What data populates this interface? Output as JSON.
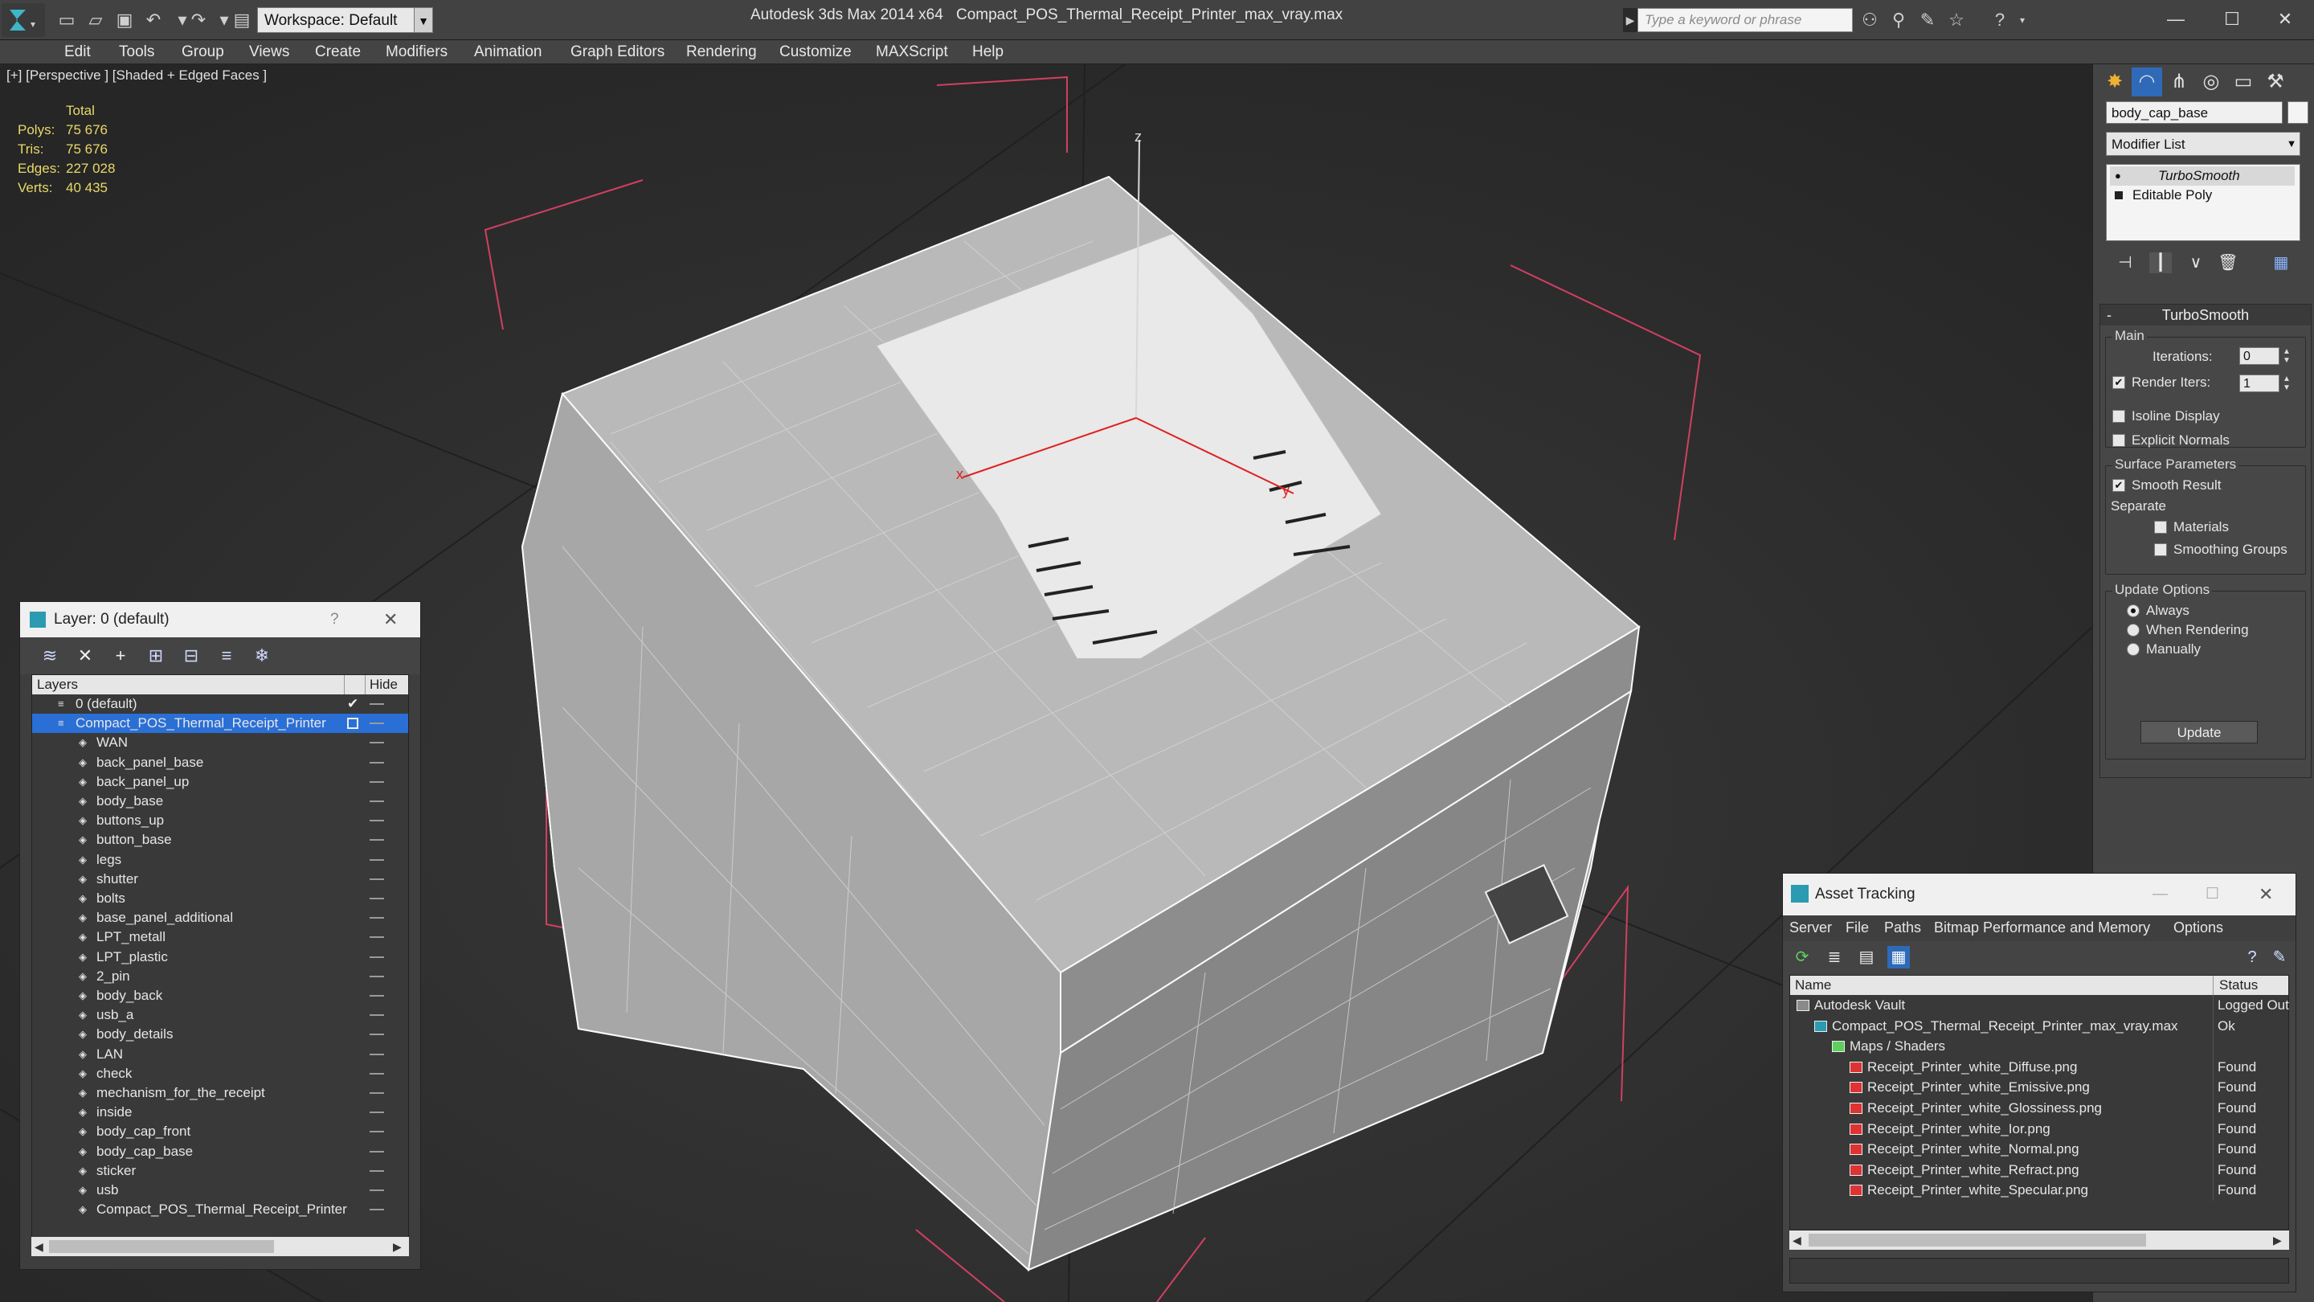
{
  "window": {
    "app_title": "Autodesk 3ds Max  2014 x64",
    "doc_title": "Compact_POS_Thermal_Receipt_Printer_max_vray.max",
    "workspace_label": "Workspace: Default",
    "search_placeholder": "Type a keyword or phrase"
  },
  "menu": [
    "Edit",
    "Tools",
    "Group",
    "Views",
    "Create",
    "Modifiers",
    "Animation",
    "Graph Editors",
    "Rendering",
    "Customize",
    "MAXScript",
    "Help"
  ],
  "viewport": {
    "label": "[+] [Perspective ] [Shaded + Edged Faces ]",
    "stats": {
      "header": "Total",
      "rows": [
        {
          "label": "Polys:",
          "value": "75 676"
        },
        {
          "label": "Tris:",
          "value": "75 676"
        },
        {
          "label": "Edges:",
          "value": "227 028"
        },
        {
          "label": "Verts:",
          "value": "40 435"
        }
      ]
    },
    "axis_labels": {
      "z": "z",
      "x": "x",
      "y": "y"
    }
  },
  "layer_panel": {
    "title": "Layer: 0 (default)",
    "help": "?",
    "col_layers": "Layers",
    "col_hide": "Hide",
    "rows": [
      {
        "name": "0 (default)",
        "kind": "layer"
      },
      {
        "name": "Compact_POS_Thermal_Receipt_Printer",
        "kind": "layer-selected"
      },
      {
        "name": "WAN",
        "kind": "object"
      },
      {
        "name": "back_panel_base",
        "kind": "object"
      },
      {
        "name": "back_panel_up",
        "kind": "object"
      },
      {
        "name": "body_base",
        "kind": "object"
      },
      {
        "name": "buttons_up",
        "kind": "object"
      },
      {
        "name": "button_base",
        "kind": "object"
      },
      {
        "name": "legs",
        "kind": "object"
      },
      {
        "name": "shutter",
        "kind": "object"
      },
      {
        "name": "bolts",
        "kind": "object"
      },
      {
        "name": "base_panel_additional",
        "kind": "object"
      },
      {
        "name": "LPT_metall",
        "kind": "object"
      },
      {
        "name": "LPT_plastic",
        "kind": "object"
      },
      {
        "name": "2_pin",
        "kind": "object"
      },
      {
        "name": "body_back",
        "kind": "object"
      },
      {
        "name": "usb_a",
        "kind": "object"
      },
      {
        "name": "body_details",
        "kind": "object"
      },
      {
        "name": "LAN",
        "kind": "object"
      },
      {
        "name": "check",
        "kind": "object"
      },
      {
        "name": "mechanism_for_the_receipt",
        "kind": "object"
      },
      {
        "name": "inside",
        "kind": "object"
      },
      {
        "name": "body_cap_front",
        "kind": "object"
      },
      {
        "name": "body_cap_base",
        "kind": "object"
      },
      {
        "name": "sticker",
        "kind": "object"
      },
      {
        "name": "usb",
        "kind": "object"
      },
      {
        "name": "Compact_POS_Thermal_Receipt_Printer",
        "kind": "object"
      }
    ]
  },
  "command_panel": {
    "object_name": "body_cap_base",
    "modifier_list": "Modifier List",
    "stack": [
      "TurboSmooth",
      "Editable Poly"
    ],
    "rollout_title": "TurboSmooth",
    "main_group": "Main",
    "iterations_label": "Iterations:",
    "iterations_value": "0",
    "render_iters_label": "Render Iters:",
    "render_iters_value": "1",
    "isoline_label": "Isoline Display",
    "explicit_label": "Explicit Normals",
    "surface_group": "Surface Parameters",
    "smooth_result_label": "Smooth Result",
    "separate_label": "Separate",
    "materials_label": "Materials",
    "smoothing_groups_label": "Smoothing Groups",
    "update_group": "Update Options",
    "always_label": "Always",
    "when_rendering_label": "When Rendering",
    "manually_label": "Manually",
    "update_button": "Update"
  },
  "asset_tracking": {
    "title": "Asset Tracking",
    "menu": [
      "Server",
      "File",
      "Paths",
      "Bitmap Performance and Memory",
      "Options"
    ],
    "col_name": "Name",
    "col_status": "Status",
    "rows": [
      {
        "name": "Autodesk Vault",
        "status": "Logged Out",
        "level": 0,
        "icon": "vault"
      },
      {
        "name": "Compact_POS_Thermal_Receipt_Printer_max_vray.max",
        "status": "Ok",
        "level": 1,
        "icon": "max"
      },
      {
        "name": "Maps / Shaders",
        "status": "",
        "level": 2,
        "icon": "maps"
      },
      {
        "name": "Receipt_Printer_white_Diffuse.png",
        "status": "Found",
        "level": 3,
        "icon": "png"
      },
      {
        "name": "Receipt_Printer_white_Emissive.png",
        "status": "Found",
        "level": 3,
        "icon": "png"
      },
      {
        "name": "Receipt_Printer_white_Glossiness.png",
        "status": "Found",
        "level": 3,
        "icon": "png"
      },
      {
        "name": "Receipt_Printer_white_Ior.png",
        "status": "Found",
        "level": 3,
        "icon": "png"
      },
      {
        "name": "Receipt_Printer_white_Normal.png",
        "status": "Found",
        "level": 3,
        "icon": "png"
      },
      {
        "name": "Receipt_Printer_white_Refract.png",
        "status": "Found",
        "level": 3,
        "icon": "png"
      },
      {
        "name": "Receipt_Printer_white_Specular.png",
        "status": "Found",
        "level": 3,
        "icon": "png"
      }
    ]
  },
  "colors": {
    "selection_blue": "#2a6fd6",
    "stats_yellow": "#e8d86a",
    "bbox_red": "#d04060"
  }
}
